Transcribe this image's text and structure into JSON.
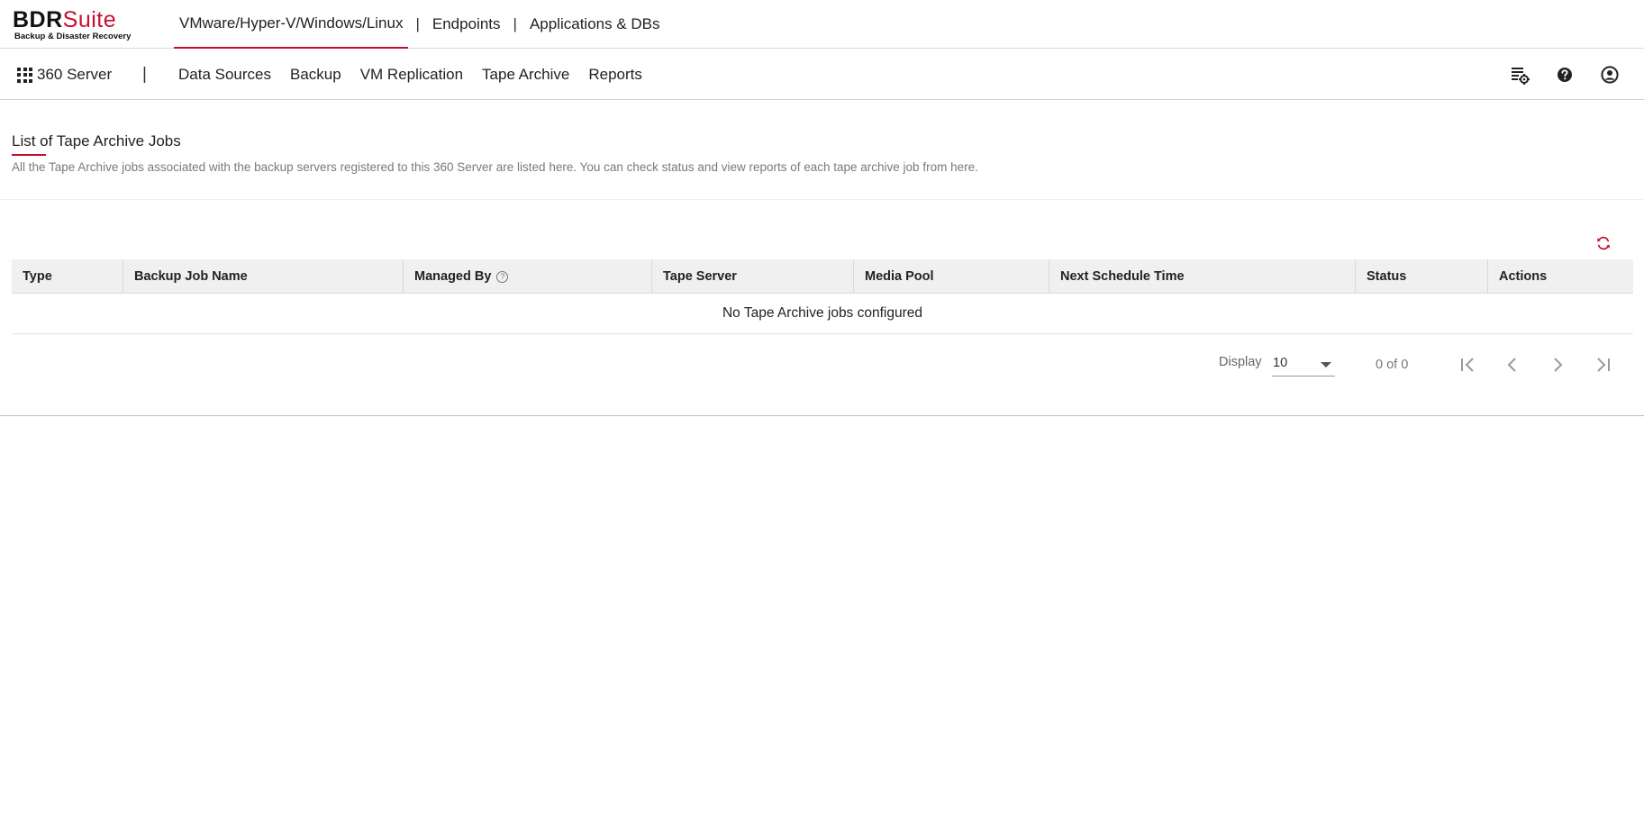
{
  "brand": {
    "logo_primary": "BDR",
    "logo_accent": "Suite",
    "tagline": "Backup & Disaster Recovery",
    "accent_color": "#c8102e"
  },
  "topnav": {
    "items": [
      {
        "label": "VMware/Hyper-V/Windows/Linux",
        "active": true
      },
      {
        "label": "Endpoints",
        "active": false
      },
      {
        "label": "Applications & DBs",
        "active": false
      }
    ],
    "separator": "|"
  },
  "subnav": {
    "app_switcher_label": "360 Server",
    "separator": "|",
    "items": [
      {
        "label": "Data Sources"
      },
      {
        "label": "Backup"
      },
      {
        "label": "VM Replication"
      },
      {
        "label": "Tape Archive"
      },
      {
        "label": "Reports"
      }
    ],
    "right_icons": [
      "settings-list-icon",
      "help-icon",
      "user-account-icon"
    ]
  },
  "page": {
    "title": "List of Tape Archive Jobs",
    "description": "All the Tape Archive jobs associated with the backup servers registered to this 360 Server are listed here. You can check status and view reports of each tape archive job from here."
  },
  "table": {
    "columns": [
      {
        "label": "Type"
      },
      {
        "label": "Backup Job Name"
      },
      {
        "label": "Managed By",
        "help": "?"
      },
      {
        "label": "Tape Server"
      },
      {
        "label": "Media Pool"
      },
      {
        "label": "Next Schedule Time"
      },
      {
        "label": "Status"
      },
      {
        "label": "Actions"
      }
    ],
    "empty_message": "No Tape Archive jobs configured"
  },
  "pagination": {
    "display_label": "Display",
    "page_size": "10",
    "count_text": "0 of 0"
  }
}
